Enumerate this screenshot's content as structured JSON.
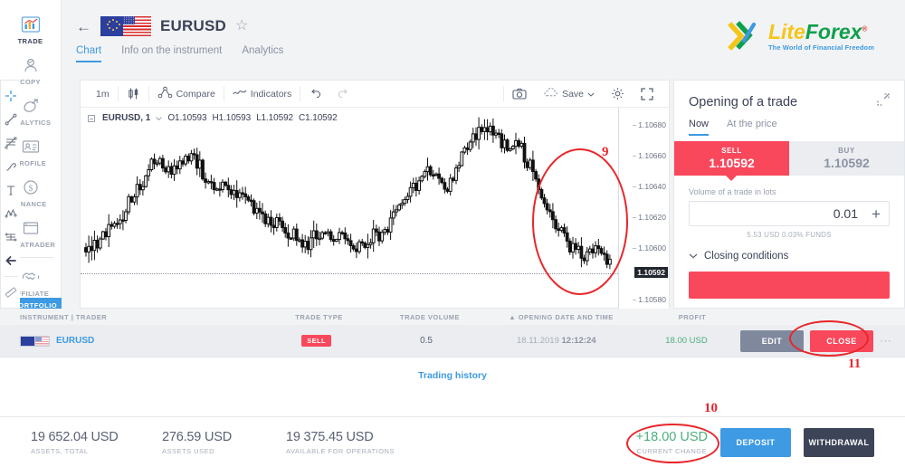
{
  "sidebar": {
    "items": [
      {
        "label": "TRADE",
        "icon": "chart-bars-icon",
        "active": true
      },
      {
        "label": "COPY",
        "icon": "person-copy-icon",
        "active": false
      },
      {
        "label": "ANALYTICS",
        "icon": "analytics-icon",
        "active": false
      },
      {
        "label": "PROFILE",
        "icon": "profile-card-icon",
        "active": false
      },
      {
        "label": "FINANCE",
        "icon": "dollar-circle-icon",
        "active": false
      },
      {
        "label": "METATRADER",
        "icon": "window-icon",
        "active": false
      },
      {
        "label": "AFFILIATE",
        "icon": "handshake-icon",
        "active": false
      }
    ],
    "portfolio_tab": "PORTFOLIO"
  },
  "header": {
    "back_icon": "back-arrow-icon",
    "pair": "EURUSD",
    "favorite_icon": "star-icon",
    "tabs": [
      {
        "label": "Chart",
        "active": true
      },
      {
        "label": "Info on the instrument",
        "active": false
      },
      {
        "label": "Analytics",
        "active": false
      }
    ]
  },
  "logo": {
    "name_part1": "Lite",
    "name_part2": "Forex",
    "registered": "®",
    "tagline": "The World of Financial Freedom"
  },
  "chart": {
    "toolbar": {
      "timeframe": "1m",
      "candle_type_icon": "candlestick-icon",
      "compare": "Compare",
      "indicators": "Indicators",
      "undo_icon": "undo-icon",
      "redo_icon": "redo-icon",
      "camera_icon": "camera-icon",
      "save": "Save",
      "save_caret_icon": "chevron-down-icon",
      "settings_icon": "gear-icon",
      "fullscreen_icon": "fullscreen-icon"
    },
    "legend": {
      "collapse_icon": "collapse-box-icon",
      "symbol": "EURUSD, 1",
      "caret_icon": "chevron-down-icon",
      "open": "O1.10593",
      "high": "H1.10593",
      "low": "L1.10592",
      "close": "C1.10592"
    },
    "price_axis": {
      "ticks": [
        "1.10680",
        "1.10660",
        "1.10640",
        "1.10620",
        "1.10600",
        "1.10580"
      ],
      "current": "1.10592"
    },
    "draw_tools": [
      "crosshair-icon",
      "trendline-icon",
      "fib-retracement-icon",
      "brush-icon",
      "text-icon",
      "pattern-icon",
      "long-position-icon",
      "arrow-left-icon",
      "ruler-icon"
    ]
  },
  "trade_panel": {
    "title": "Opening of a trade",
    "expand_icon": "expand-icon",
    "tabs": [
      {
        "label": "Now",
        "active": true
      },
      {
        "label": "At the price",
        "active": false
      }
    ],
    "sell": {
      "label": "SELL",
      "price": "1.10592"
    },
    "buy": {
      "label": "BUY",
      "price": "1.10592"
    },
    "volume_label": "Volume of a trade in lots",
    "volume_value": "0.01",
    "plus_icon": "plus-icon",
    "volume_sub": "5.53 USD   0.03% FUNDS",
    "closing_conditions": "Closing conditions",
    "closing_caret_icon": "chevron-down-icon",
    "colors": {
      "sell": "#f9485b",
      "buy_bg": "#ebedf0",
      "accent": "#3d9ae3"
    }
  },
  "table": {
    "headers": {
      "instrument": "INSTRUMENT | TRADER",
      "trade_type": "TRADE TYPE",
      "trade_volume": "TRADE VOLUME",
      "opening_date": "OPENING DATE AND TIME",
      "sort_icon": "sort-asc-icon",
      "profit": "PROFIT"
    },
    "rows": [
      {
        "flags_icon": "eu-us-flags-icon",
        "symbol": "EURUSD",
        "trade_type": "SELL",
        "trade_volume": "0.5",
        "date": "18.11.2019",
        "time": "12:12:24",
        "profit": "18.00 USD",
        "edit_label": "EDIT",
        "close_label": "CLOSE",
        "more_icon": "more-dots-icon"
      }
    ],
    "history_link": "Trading history"
  },
  "summary": {
    "stats": [
      {
        "value": "19 652.04 USD",
        "label": "ASSETS, TOTAL"
      },
      {
        "value": "276.59 USD",
        "label": "ASSETS USED"
      },
      {
        "value": "19 375.45 USD",
        "label": "AVAILABLE FOR OPERATIONS"
      }
    ],
    "change_value": "+18.00 USD",
    "change_label": "CURRENT CHANGE",
    "deposit": "DEPOSIT",
    "withdrawal": "WITHDRAWAL"
  },
  "annotations": [
    {
      "number": "9",
      "target": "chart-region"
    },
    {
      "number": "10",
      "target": "current-change"
    },
    {
      "number": "11",
      "target": "close-button"
    }
  ]
}
